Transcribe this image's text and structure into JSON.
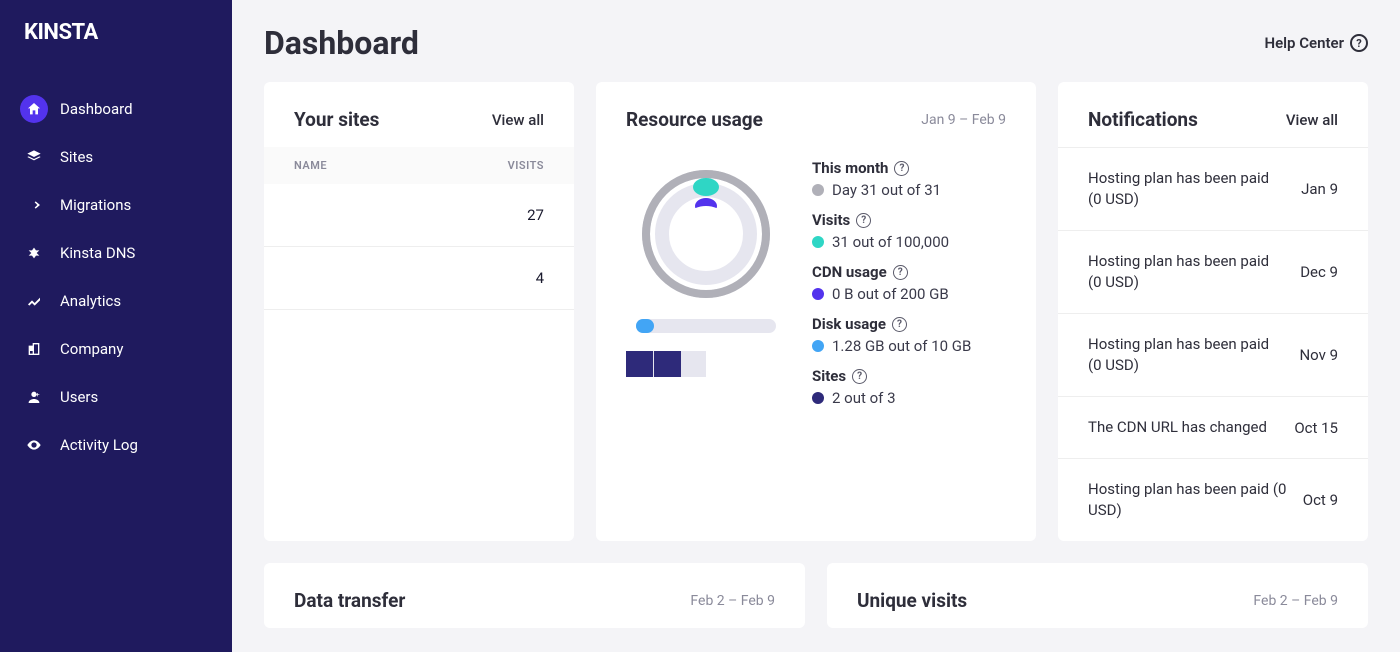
{
  "brand": "KINSTA",
  "page_title": "Dashboard",
  "help_center": "Help Center",
  "sidebar": {
    "items": [
      {
        "label": "Dashboard",
        "icon": "home",
        "active": true
      },
      {
        "label": "Sites",
        "icon": "layers",
        "active": false
      },
      {
        "label": "Migrations",
        "icon": "migrate",
        "active": false
      },
      {
        "label": "Kinsta DNS",
        "icon": "dns",
        "active": false
      },
      {
        "label": "Analytics",
        "icon": "analytics",
        "active": false
      },
      {
        "label": "Company",
        "icon": "company",
        "active": false
      },
      {
        "label": "Users",
        "icon": "users",
        "active": false
      },
      {
        "label": "Activity Log",
        "icon": "eye",
        "active": false
      }
    ]
  },
  "your_sites": {
    "title": "Your sites",
    "view_all": "View all",
    "col_name": "NAME",
    "col_visits": "VISITS",
    "rows": [
      {
        "name": "",
        "visits": "27"
      },
      {
        "name": "",
        "visits": "4"
      }
    ]
  },
  "resource": {
    "title": "Resource usage",
    "date_range": "Jan 9 – Feb 9",
    "metrics": [
      {
        "title": "This month",
        "info": true,
        "dot": "#b0b0b8",
        "value": "Day 31 out of 31"
      },
      {
        "title": "Visits",
        "info": true,
        "dot": "#2fd6c5",
        "value": "31 out of 100,000"
      },
      {
        "title": "CDN usage",
        "info": true,
        "dot": "#5333ed",
        "value": "0 B out of 200 GB"
      },
      {
        "title": "Disk usage",
        "info": true,
        "dot": "#42a5f5",
        "value": "1.28 GB out of 10 GB"
      },
      {
        "title": "Sites",
        "info": true,
        "dot": "#2e2a7a",
        "value": "2 out of 3"
      }
    ]
  },
  "notifications": {
    "title": "Notifications",
    "view_all": "View all",
    "items": [
      {
        "text": "Hosting plan has been paid (0 USD)",
        "date": "Jan 9"
      },
      {
        "text": "Hosting plan has been paid (0 USD)",
        "date": "Dec 9"
      },
      {
        "text": "Hosting plan has been paid (0 USD)",
        "date": "Nov 9"
      },
      {
        "text": "The CDN URL has changed",
        "date": "Oct 15"
      },
      {
        "text": "Hosting plan has been paid (0 USD)",
        "date": "Oct 9"
      }
    ]
  },
  "data_transfer": {
    "title": "Data transfer",
    "date_range": "Feb 2 – Feb 9"
  },
  "unique_visits": {
    "title": "Unique visits",
    "date_range": "Feb 2 – Feb 9"
  }
}
